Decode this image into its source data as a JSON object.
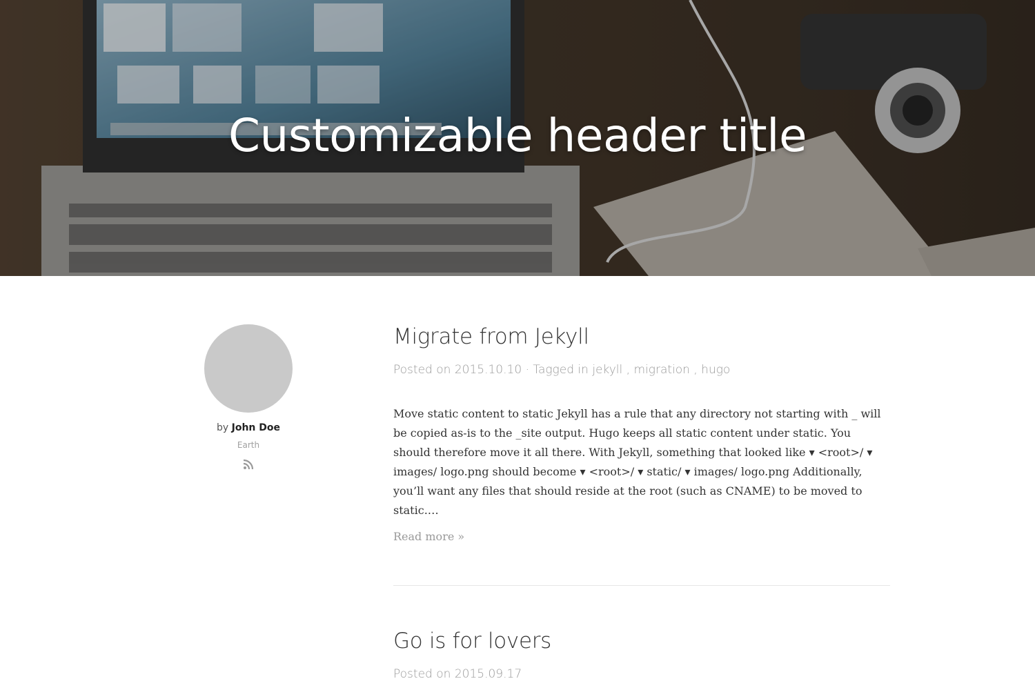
{
  "hero": {
    "title": "Customizable header title"
  },
  "author": {
    "by_prefix": "by",
    "name": "John Doe",
    "location": "Earth",
    "rss_icon": "rss-icon"
  },
  "posts": [
    {
      "title": "Migrate from Jekyll",
      "meta_prefix": "Posted on",
      "date": "2015.10.10",
      "tagged_prefix": "· Tagged in",
      "tags": [
        "jekyll",
        "migration",
        "hugo"
      ],
      "excerpt": "Move static content to static Jekyll has a rule that any directory not starting with _ will be copied as-is to the _site output. Hugo keeps all static content under static. You should therefore move it all there. With Jekyll, something that looked like ▾ <root>/ ▾ images/ logo.png should become ▾ <root>/ ▾ static/ ▾ images/ logo.png Additionally, you’ll want any files that should reside at the root (such as CNAME) to be moved to static.…",
      "read_more": "Read more »"
    },
    {
      "title": "Go is for lovers",
      "meta_prefix": "Posted on",
      "date": "2015.09.17"
    }
  ],
  "colors": {
    "avatar": "#c9c9c9",
    "meta": "#9a9a9a",
    "divider": "#e6e6e6"
  }
}
